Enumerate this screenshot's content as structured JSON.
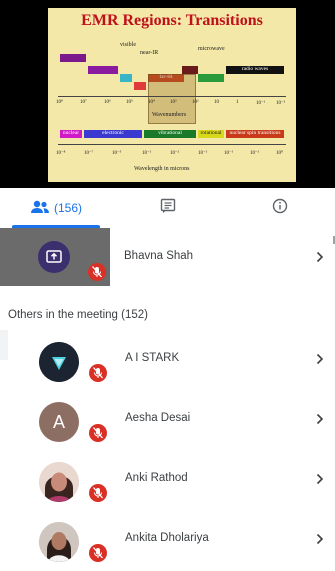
{
  "slide": {
    "title": "EMR Regions: Transitions",
    "region_labels": {
      "visible": "visible",
      "near_ir": "near-IR",
      "microwave": "microwave",
      "radio_waves": "radio waves",
      "far_ir": "far-IR"
    },
    "wavenumber_ticks": [
      "10⁸",
      "10⁷",
      "10⁶",
      "10⁵",
      "10⁴",
      "10³",
      "10²",
      "10",
      "1",
      "10⁻¹",
      "10⁻²"
    ],
    "wavenumber_label": "Wavenumbers",
    "transition_labels": {
      "nuclear": "nuclear",
      "electronic": "electronic",
      "vibrational": "vibrational",
      "rotational": "rotational",
      "nuclear_spin": "nuclear spin transitions"
    },
    "wavelength_ticks": [
      "10⁻⁸",
      "10⁻⁷",
      "10⁻⁵",
      "10⁻¹",
      "10⁻²",
      "10⁻¹",
      "10⁻¹",
      "10⁻¹",
      "10⁰"
    ],
    "wavelength_label": "Wavelength in microns"
  },
  "tabs": {
    "people_count": "(156)",
    "people_icon": "people-icon",
    "chat_icon": "chat-icon",
    "info_icon": "info-icon"
  },
  "presenter": {
    "name": "Bhavna Shah",
    "icon": "present-screen-icon"
  },
  "others": {
    "title": "Others in the meeting (152)"
  },
  "participants": [
    {
      "name": "A I STARK",
      "avatar": "logo",
      "avatar_color": "#1b2430"
    },
    {
      "name": "Aesha Desai",
      "avatar": "letter",
      "letter": "A",
      "avatar_color": "#8d6e63"
    },
    {
      "name": "Anki Rathod",
      "avatar": "photo",
      "avatar_color": "#c98b79"
    },
    {
      "name": "Ankita Dholariya",
      "avatar": "photo",
      "avatar_color": "#6d4c41"
    }
  ],
  "colors": {
    "accent": "#1a73e8",
    "mic_off": "#d93025",
    "text": "#3c4043"
  }
}
